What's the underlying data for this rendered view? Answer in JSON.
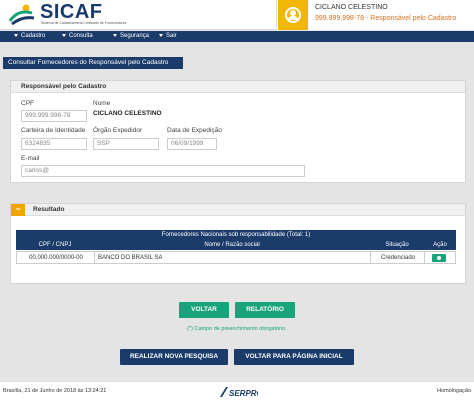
{
  "header": {
    "app_name": "SICAF",
    "app_subtitle": "Sistema de Cadastramento Unificado de Fornecedores",
    "user_name": "CICLANO CELESTINO",
    "user_cpf_role": "999.999.998-78 - Responsável pelo Cadastro"
  },
  "nav": {
    "items": [
      {
        "label": "Cadastro"
      },
      {
        "label": "Consulta"
      },
      {
        "label": "Segurança"
      },
      {
        "label": "Sair"
      }
    ]
  },
  "page": {
    "title": "Consultar Fornecedores do Responsável pelo Cadastro"
  },
  "responsavel": {
    "heading": "Responsável pelo Cadastro",
    "cpf_label": "CPF",
    "cpf_value": "999.999.998-78",
    "nome_label": "Nome",
    "nome_value": "CICLANO CELESTINO",
    "identidade_label": "Carteira de Identidade",
    "identidade_value": "6324835",
    "orgao_label": "Órgão Expedidor",
    "orgao_value": "SSP",
    "data_label": "Data de Expedição",
    "data_value": "06/09/1999",
    "email_label": "E-mail",
    "email_value": "carlos@"
  },
  "resultado": {
    "heading": "Resultado",
    "collapse_symbol": "−",
    "table_caption": "Fornecedores Nacionais sob responsabilidade (Total: 1)",
    "columns": {
      "cpf_cnpj": "CPF / CNPJ",
      "nome": "Nome / Razão social",
      "situacao": "Situação",
      "acao": "Ação"
    },
    "rows": [
      {
        "cpf_cnpj": "00.000.000/0000-00",
        "nome": "BANCO DO BRASIL SA",
        "situacao": "Credenciado"
      }
    ]
  },
  "actions": {
    "voltar": "VOLTAR",
    "relatorio": "RELATÓRIO",
    "required_note": "(*) Campo de preenchimento obrigatório.",
    "nova_pesquisa": "REALIZAR NOVA PESQUISA",
    "pagina_inicial": "VOLTAR PARA PÁGINA INICIAL"
  },
  "footer": {
    "date": "Brasília, 21 de Junho de 2018 às 13:24:21",
    "brand": "SERPRO",
    "environment": "Homologação"
  },
  "colors": {
    "navy": "#1b3c6b",
    "green": "#19a37b",
    "orange": "#f0a500",
    "avatar_yellow": "#f2b705",
    "cpf_orange": "#d9701e"
  }
}
